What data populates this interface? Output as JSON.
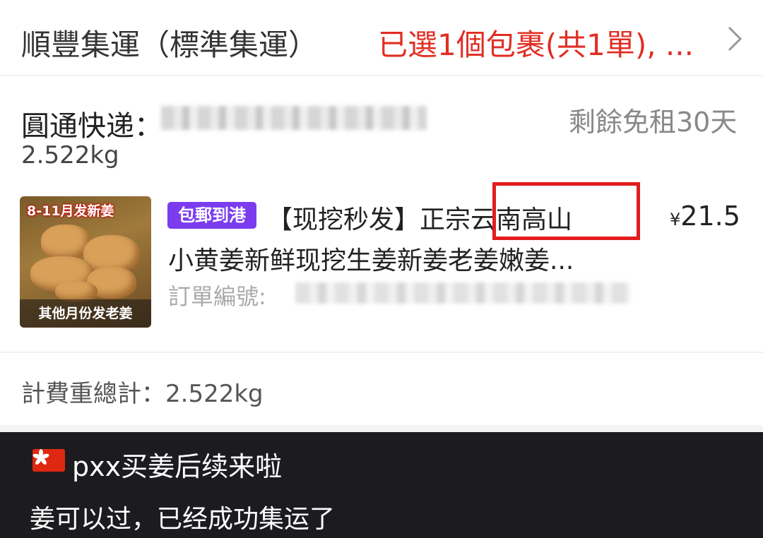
{
  "header": {
    "title": "順豐集運（標準集運）",
    "summary": "已選1個包裹(共1單), ..."
  },
  "package": {
    "carrier_label": "圓通快递：",
    "free_days": "剩餘免租30天",
    "weight": "2.522kg",
    "product": {
      "thumb_top_text": "8-11月发新姜",
      "thumb_bottom_text": "其他月份发老姜",
      "badge": "包郵到港",
      "title_line1": "【现挖秒发】正宗云南高山",
      "title_line2": "小黄姜新鲜现挖生姜新姜老姜嫩姜...",
      "price_symbol": "¥",
      "price_value": "21.5",
      "order_label": "訂單編號: "
    }
  },
  "total": {
    "text": "計費重總計：2.522kg"
  },
  "caption": {
    "line1": "pxx买姜后续来啦",
    "line2": "姜可以过，已经成功集运了"
  },
  "colors": {
    "accent_red": "#e02e24",
    "badge_purple": "#7b3cf0",
    "highlight_red": "#e21d1d",
    "caption_bg": "#1c1c20"
  },
  "icons": {
    "chevron": "chevron-right-icon",
    "flag": "hong-kong-flag-icon"
  }
}
